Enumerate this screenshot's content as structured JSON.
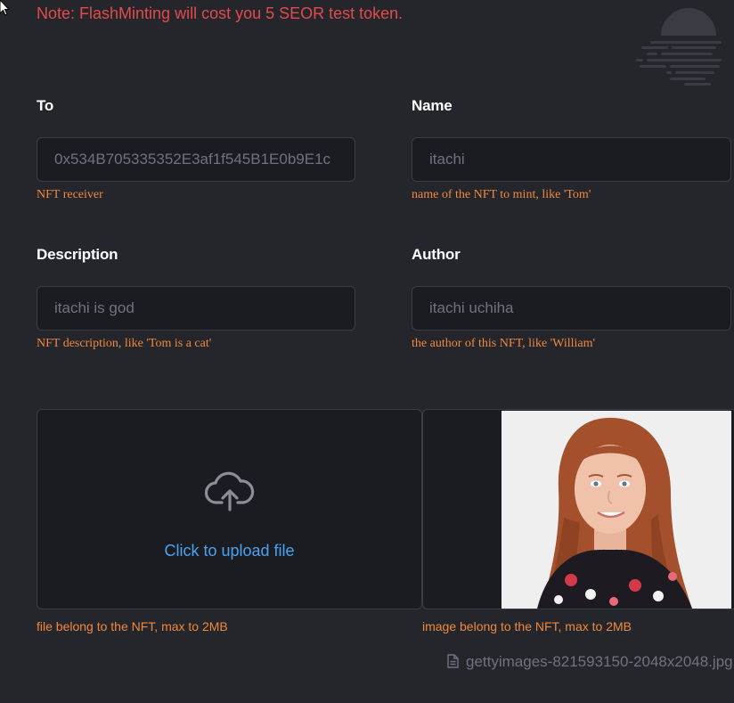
{
  "note": "Note: FlashMinting will cost you 5 SEOR test token.",
  "fields": {
    "to": {
      "label": "To",
      "value": "0x534B705335352E3af1f545B1E0b9E1c",
      "help": "NFT receiver"
    },
    "name": {
      "label": "Name",
      "value": "itachi",
      "help": "name of the NFT to mint, like 'Tom'"
    },
    "description": {
      "label": "Description",
      "value": "itachi is god",
      "help": "NFT description, like 'Tom is a cat'"
    },
    "author": {
      "label": "Author",
      "value": "itachi uchiha",
      "help": "the author of this NFT, like 'William'"
    }
  },
  "upload": {
    "label": "Click to upload file",
    "help": "file belong to the NFT, max to 2MB",
    "icon": "cloud-upload-icon"
  },
  "image": {
    "help": "image belong to the NFT, max to 2MB",
    "filename": "gettyimages-821593150-2048x2048.jpg",
    "icon": "file-icon"
  },
  "colors": {
    "background": "#24262c",
    "note": "#e24b4b",
    "help": "#f0883e",
    "link": "#4aa3f0",
    "input_bg": "#1b1c21"
  }
}
